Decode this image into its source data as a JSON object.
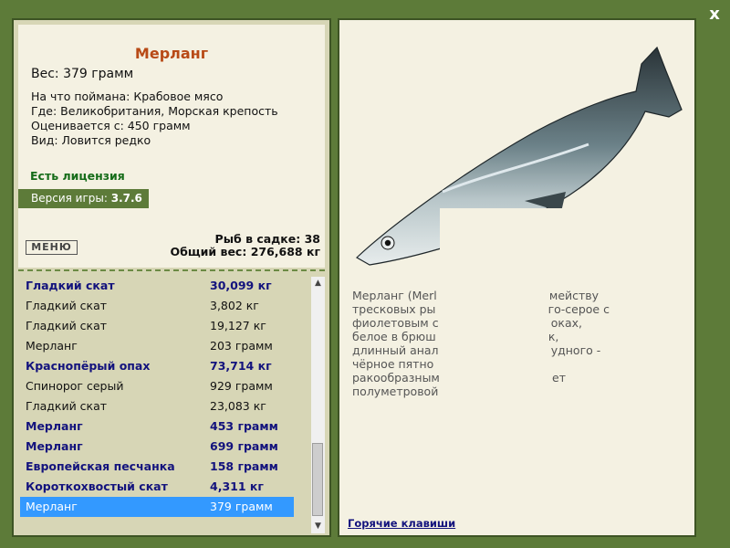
{
  "close_label": "x",
  "fish": {
    "name": "Мерланг",
    "weight_line": "Вес: 379 грамм",
    "bait_line": "На что поймана: Крабовое мясо",
    "place_line": "Где: Великобритания, Морская крепость",
    "value_line": "Оценивается с: 450 грамм",
    "rarity_line": "Вид: Ловится редко"
  },
  "license": "Есть лицензия",
  "version": {
    "label": "Версия игры:",
    "value": "3.7.6"
  },
  "menu_button": "МЕНЮ",
  "keep": {
    "count_line": "Рыб в садке: 38",
    "total_line": "Общий вес: 276,688 кг"
  },
  "catch_list": [
    {
      "name": "Гладкий скат",
      "weight": "30,099 кг",
      "bold": true
    },
    {
      "name": "Гладкий скат",
      "weight": "3,802 кг",
      "bold": false
    },
    {
      "name": "Гладкий скат",
      "weight": "19,127 кг",
      "bold": false
    },
    {
      "name": "Мерланг",
      "weight": "203 грамм",
      "bold": false
    },
    {
      "name": "Краснопёрый опах",
      "weight": "73,714 кг",
      "bold": true
    },
    {
      "name": "Спинорог серый",
      "weight": "929 грамм",
      "bold": false
    },
    {
      "name": "Гладкий скат",
      "weight": "23,083 кг",
      "bold": false
    },
    {
      "name": "Мерланг",
      "weight": "453 грамм",
      "bold": true
    },
    {
      "name": "Мерланг",
      "weight": "699 грамм",
      "bold": true
    },
    {
      "name": "Европейская песчанка",
      "weight": "158 грамм",
      "bold": true
    },
    {
      "name": "Короткохвостый скат",
      "weight": "4,311 кг",
      "bold": true
    },
    {
      "name": "Мерланг",
      "weight": "379 грамм",
      "bold": false,
      "selected": true
    }
  ],
  "description_lines": [
    "Мерланг (Merl                               мейству",
    "тресковых ры                               го-серое с",
    "фиолетовым с                               оках,",
    "белое в брюш                               к,",
    "длинный анал                               удного -",
    "чёрное пятно",
    "ракообразным                               ет",
    "полуметровой"
  ],
  "hotkeys": "Горячие клавиши",
  "colors": {
    "frame": "#5d7b39",
    "title": "#b84a16",
    "license": "#156c19",
    "bold_row": "#13137d",
    "selected": "#3399ff"
  }
}
